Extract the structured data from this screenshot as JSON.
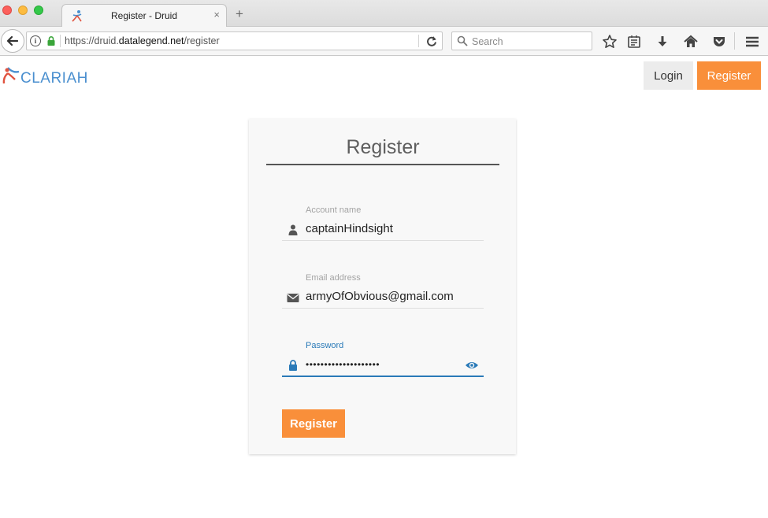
{
  "browser": {
    "tab_title": "Register - Druid",
    "tab_close": "×",
    "new_tab": "+",
    "url_host_prefix": "https://druid.",
    "url_domain": "datalegend.net",
    "url_path": "/register",
    "search_placeholder": "Search"
  },
  "header": {
    "logo_text": "CLARIAH",
    "login_label": "Login",
    "register_label": "Register"
  },
  "form": {
    "title": "Register",
    "account_label": "Account name",
    "account_value": "captainHindsight",
    "email_label": "Email address",
    "email_value": "armyOfObvious@gmail.com",
    "password_label": "Password",
    "password_value": "••••••••••••••••••••",
    "submit_label": "Register"
  },
  "colors": {
    "accent": "#f98f3a",
    "focus": "#2a7ab8",
    "logo_blue": "#4a8fcf",
    "logo_red": "#e0533f"
  }
}
